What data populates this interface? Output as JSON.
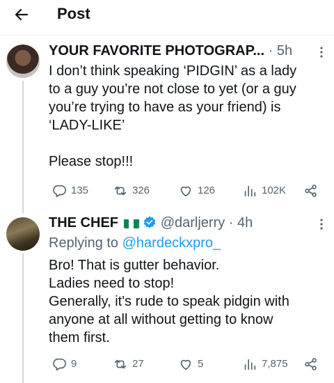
{
  "header": {
    "title": "Post"
  },
  "tweet1": {
    "name": "YOUR FAVORITE PHOTOGRAP...",
    "separator": "·",
    "time": "5h",
    "lines": [
      "I don’t think speaking ‘PIDGIN’ as a lady",
      "to a guy you’re not close to yet (or a guy",
      "you’re trying to have as your friend) is",
      "‘LADY-LIKE’",
      "",
      "Please stop!!!"
    ],
    "stats": {
      "replies": "135",
      "reposts": "326",
      "likes": "126",
      "views": "102K"
    }
  },
  "tweet2": {
    "name": "THE CHEF",
    "handle": "@darljerry",
    "separator": "·",
    "time": "4h",
    "replying_prefix": "Replying to",
    "replying_handle": "@hardeckxpro_",
    "lines": [
      "Bro! That is gutter behavior.",
      "Ladies need to stop!",
      "Generally, it's rude to speak pidgin with",
      "anyone at all without getting to know",
      "them first."
    ],
    "stats": {
      "replies": "9",
      "reposts": "27",
      "likes": "5",
      "views": "7,875"
    }
  },
  "colors": {
    "text": "#0f1419",
    "muted": "#536471",
    "link": "#1d9bf0",
    "verified": "#1d9bf0",
    "flag_green": "#008751"
  }
}
